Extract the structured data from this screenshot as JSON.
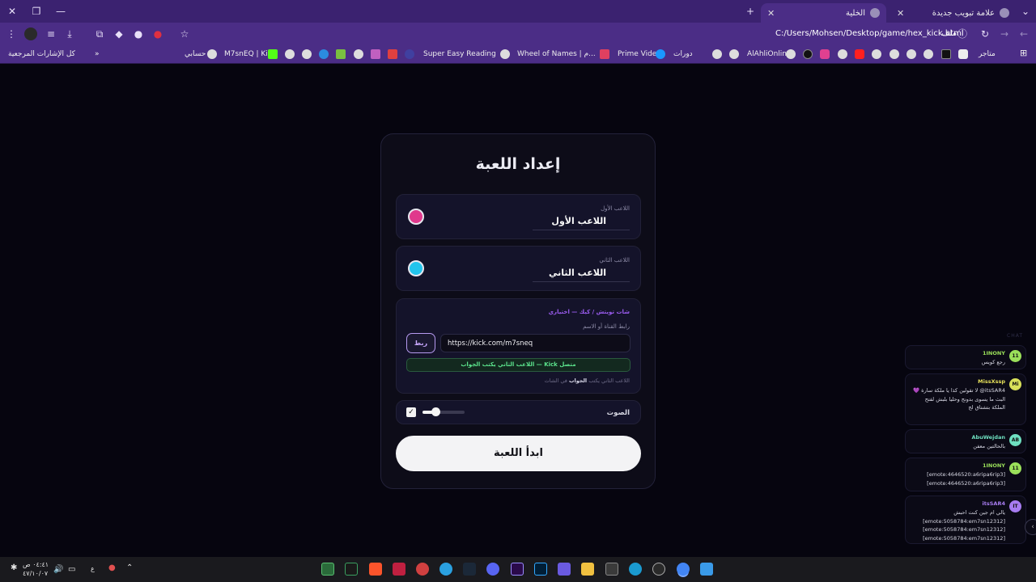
{
  "browser": {
    "tabs": [
      {
        "title": "علامة تبويب جديدة"
      },
      {
        "title": "الخلية"
      }
    ],
    "address": {
      "scheme_label": "ملف",
      "url": "C:/Users/Mohsen/Desktop/game/hex_kick.html"
    },
    "bookmarks": [
      {
        "label": "متاجر"
      },
      {
        "label": "AlAhliOnline"
      },
      {
        "label": "دورات"
      },
      {
        "label": "Prime Video"
      },
      {
        "label": "Wheel of Names | م..."
      },
      {
        "label": "Super Easy Reading"
      },
      {
        "label": "M7snEQ | Kick"
      },
      {
        "label": "حسابي"
      },
      {
        "label": "كل الإشارات المرجعية"
      }
    ]
  },
  "setup": {
    "title": "إعداد اللعبة",
    "player1": {
      "label": "اللاعب الأول",
      "name": "اللاعب الأول",
      "color": "#e0388c"
    },
    "player2": {
      "label": "اللاعب الثاني",
      "name": "اللاعب الثاني",
      "color": "#22c4ec"
    },
    "chat": {
      "title": "شات تويتش / كيك — اختياري",
      "sub_label": "رابط القناة أو الاسم",
      "url_value": "https://kick.com/m7sneq",
      "link_button": "ربط",
      "status": "متصل Kick — اللاعب الثاني يكتب الجواب",
      "hint_pre": "اللاعب الثاني يكتب",
      "hint_bold": "الجواب",
      "hint_post": "في الشات"
    },
    "sound": {
      "label": "الصوت",
      "enabled": true,
      "volume": 0.3
    },
    "start_button": "ابدأ اللعبة"
  },
  "chat_overlay": {
    "header": "CHAT",
    "messages": [
      {
        "initials": "11",
        "user": "1INONY",
        "user_color": "#9be05a",
        "avatar_color": "#9be05a",
        "text": "رجع كويس"
      },
      {
        "initials": "Mi",
        "user": "MissXssp",
        "user_color": "#e6e05a",
        "avatar_color": "#d8e05a",
        "text": "itsSAR4@ لا تقولين كذا يا ملكة سارة 💜 البث ما يسوى بدونج وحليا بلبش لفتح الملكة بتشتاق لج"
      },
      {
        "initials": "AB",
        "user": "AbuWejdan",
        "user_color": "#6ee0c0",
        "avatar_color": "#6ee0c0",
        "text": "بالحالتين معفن"
      },
      {
        "initials": "11",
        "user": "1INONY",
        "user_color": "#9be05a",
        "avatar_color": "#9be05a",
        "text": "[emote:4646520:a6ripa6rip3] [emote:4646520:a6ripa6rip3]"
      },
      {
        "initials": "IT",
        "user": "itsSAR4",
        "user_color": "#a77cf0",
        "avatar_color": "#a77cf0",
        "text": "يالي ام جين كنت احبش [emote:5058784:em7sn12312] [emote:5058784:em7sn12312] [emote:5058784:em7sn12312]"
      }
    ]
  },
  "taskbar": {
    "time": "٠٤:٤١ ص",
    "date": "٤٧/١٠/٠٧",
    "lang": "ع"
  }
}
